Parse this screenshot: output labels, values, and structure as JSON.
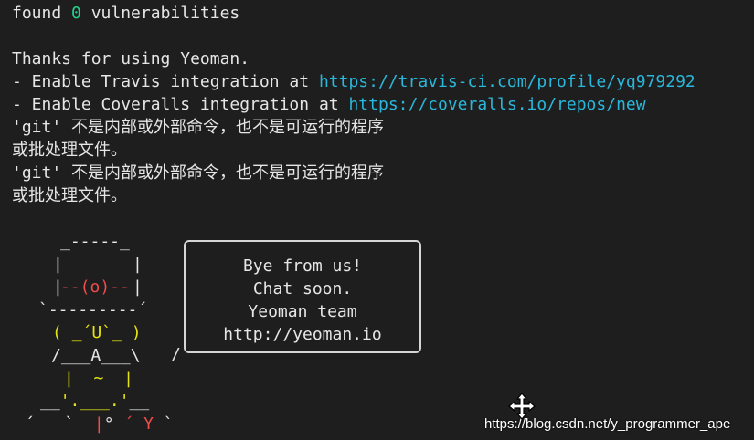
{
  "terminal": {
    "vuln_prefix": "found ",
    "vuln_count": "0",
    "vuln_suffix": " vulnerabilities",
    "thanks": "Thanks for using Yeoman.",
    "travis_prefix": "- Enable Travis integration at ",
    "travis_url": "https://travis-ci.com/profile/yq979292",
    "coveralls_prefix": "- Enable Coveralls integration at ",
    "coveralls_url": "https://coveralls.io/repos/new",
    "git_error_line1": "'git' 不是内部或外部命令，也不是可运行的程序",
    "git_error_line2": "或批处理文件。",
    "git_error_line3": "'git' 不是内部或外部命令，也不是可运行的程序",
    "git_error_line4": "或批处理文件。"
  },
  "yeoman_art": {
    "hat_top": "_-----_",
    "hat_side_left": "|",
    "hat_side_right": "|",
    "eye_left_bar": "|",
    "eye": "--(o)--",
    "eye_right_bar": "|",
    "brim": "`---------´",
    "face_left": "( ",
    "face": "_´U`_",
    "face_right": " )",
    "body": "/___A___\\",
    "arm": "/",
    "torso_left": "|",
    "torso_mid": "~",
    "torso_right": "|",
    "belt": "__'.___.'__",
    "feet_left": "´   `",
    "feet_bar": "|",
    "feet_deg": "° ",
    "feet_y": "´ Y",
    "feet_right": " `"
  },
  "speech_bubble": {
    "line1": "Bye from us!",
    "line2": "Chat soon.",
    "line3": "Yeoman team",
    "line4": "http://yeoman.io"
  },
  "watermark": "https://blog.csdn.net/y_programmer_ape",
  "colors": {
    "background": "#1e1e1e",
    "text": "#e6e6e6",
    "green": "#23d18b",
    "link": "#29b8db",
    "red": "#f14c4c",
    "yellow": "#e5e510"
  },
  "icons": [
    "move-cursor-icon"
  ]
}
